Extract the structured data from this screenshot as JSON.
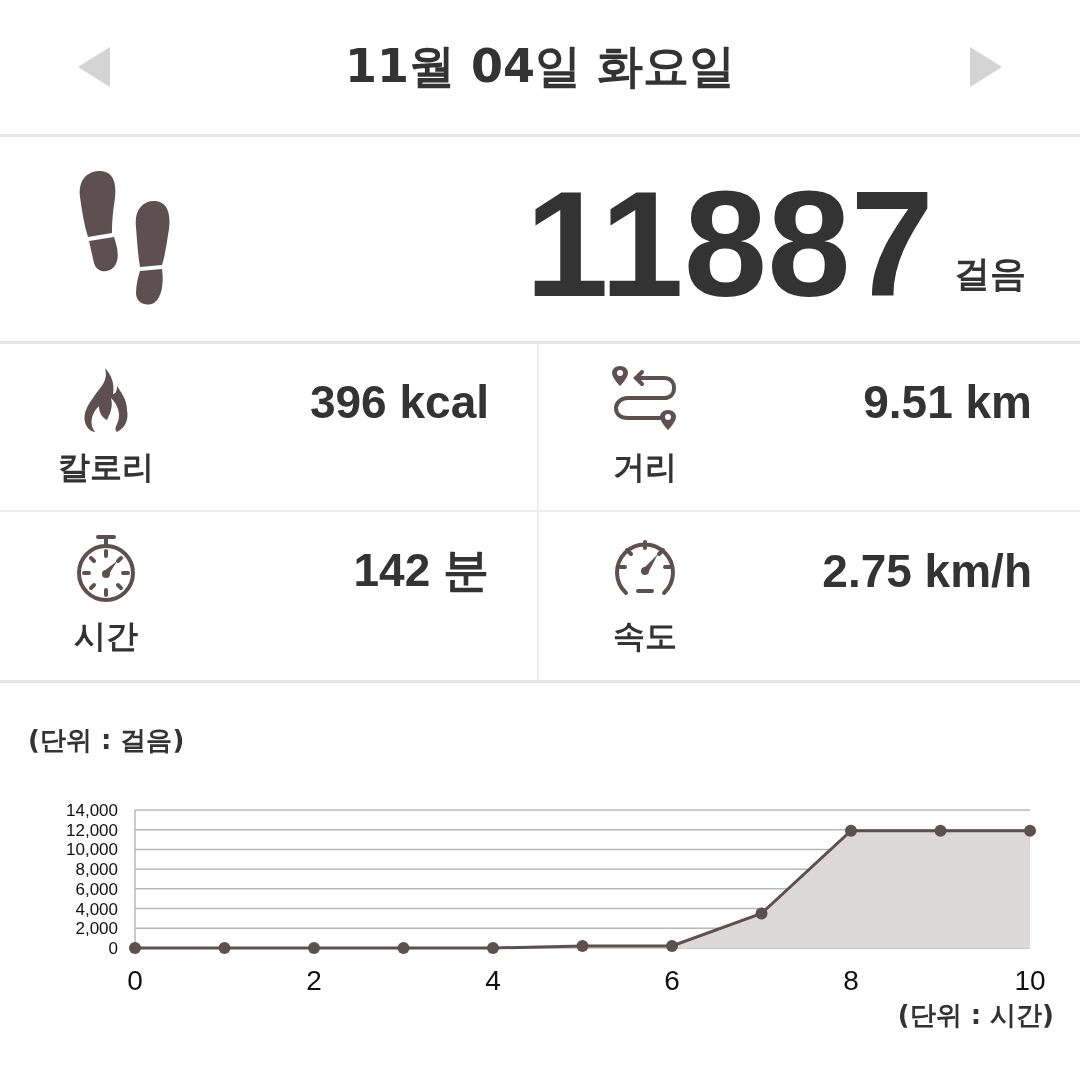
{
  "header": {
    "title": "11월 04일 화요일"
  },
  "steps": {
    "value": "11887",
    "unit": "걸음"
  },
  "stats": [
    {
      "kind": "calories",
      "value": "396 kcal",
      "label": "칼로리"
    },
    {
      "kind": "distance",
      "value": "9.51 km",
      "label": "거리"
    },
    {
      "kind": "time",
      "value": "142 분",
      "label": "시간"
    },
    {
      "kind": "speed",
      "value": "2.75 km/h",
      "label": "속도"
    }
  ],
  "chart": {
    "y_unit": "(단위 : 걸음)",
    "x_unit": "(단위 : 시간)",
    "chart_data": {
      "type": "area",
      "x": [
        0,
        1,
        2,
        3,
        4,
        5,
        6,
        7,
        8,
        9,
        10
      ],
      "series": [
        {
          "color": "#5e5050",
          "values": [
            0,
            0,
            0,
            0,
            0,
            200,
            200,
            3500,
            11900,
            11900,
            11900
          ]
        }
      ],
      "grid": true,
      "xlim": [
        0,
        10
      ],
      "ylim": [
        0,
        14000
      ],
      "xticks": [
        0,
        2,
        4,
        6,
        8,
        10
      ],
      "yticks": [
        {
          "value": 0,
          "label": "0"
        },
        {
          "value": 2000,
          "label": "2,000"
        },
        {
          "value": 4000,
          "label": "4,000"
        },
        {
          "value": 6000,
          "label": "6,000"
        },
        {
          "value": 8000,
          "label": "8,000"
        },
        {
          "value": 10000,
          "label": "10,000"
        },
        {
          "value": 12000,
          "label": "12,000"
        },
        {
          "value": 14000,
          "label": "14,000"
        }
      ]
    }
  }
}
